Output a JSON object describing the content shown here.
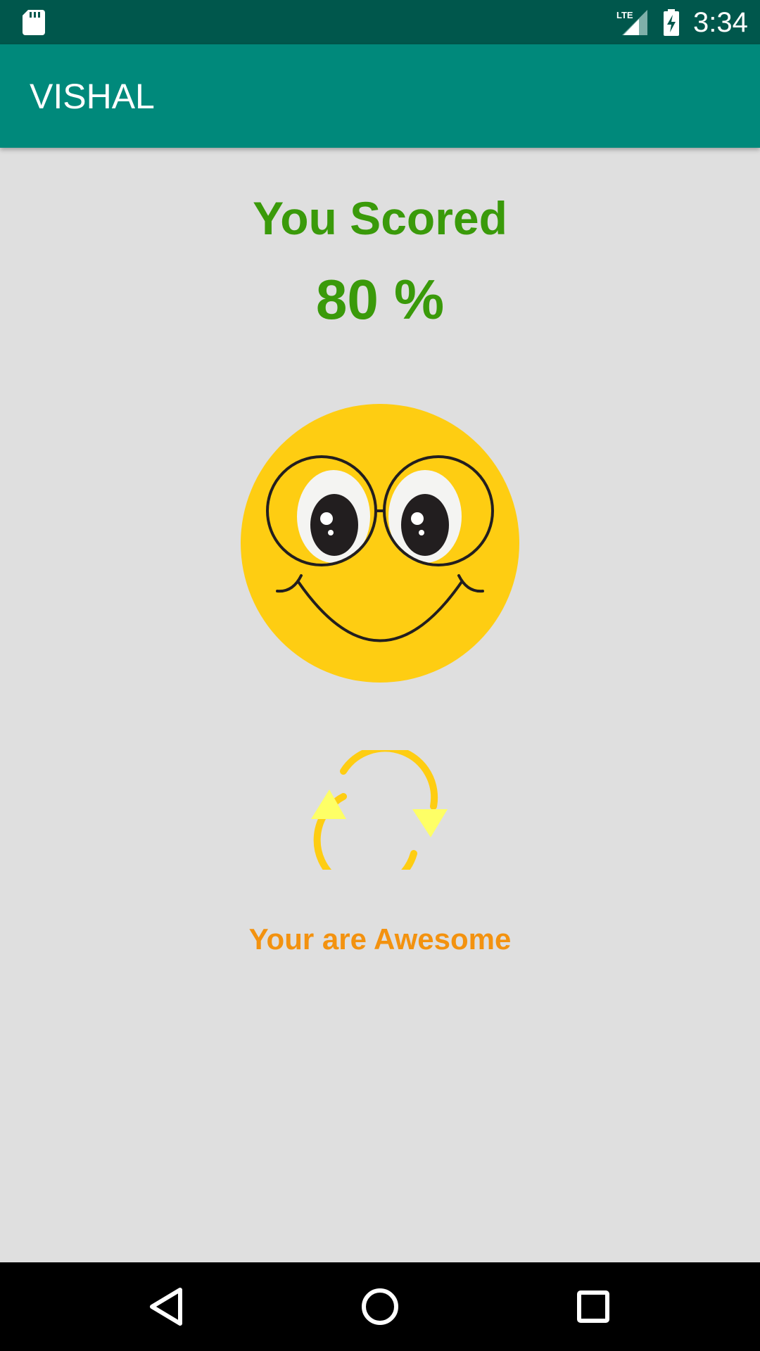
{
  "status_bar": {
    "time": "3:34",
    "network_label": "LTE",
    "icons": [
      "sd-card-icon",
      "lte-signal-icon",
      "battery-charging-icon"
    ],
    "background_color": "#00574c"
  },
  "app_bar": {
    "title": "VISHAL",
    "background_color": "#00897b"
  },
  "result": {
    "heading": "You Scored",
    "score": "80 %",
    "score_color": "#3a9a0a",
    "face_icon": "smiley-face-glasses-icon",
    "retry_icon": "refresh-icon",
    "message": "Your are Awesome",
    "message_color": "#f3920f"
  },
  "nav_bar": {
    "buttons": [
      "back-icon",
      "home-icon",
      "recents-icon"
    ]
  },
  "colors": {
    "page_background": "#dfdfdf",
    "face_yellow": "#fecd12",
    "arrow_yellow": "#feff66"
  }
}
